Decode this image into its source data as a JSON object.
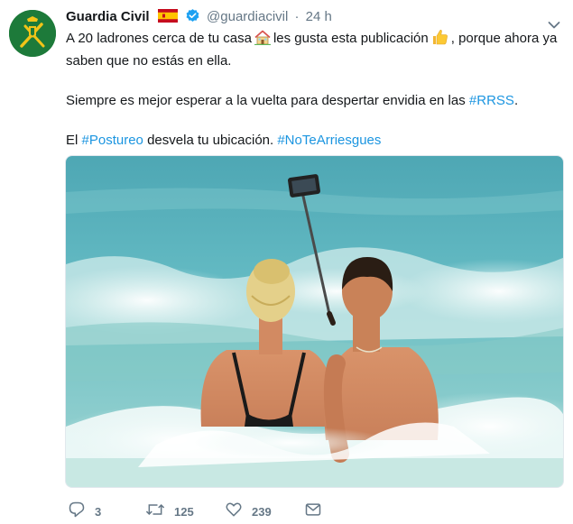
{
  "tweet": {
    "display_name": "Guardia Civil",
    "handle": "@guardiacivil",
    "separator": "·",
    "time": "24 h",
    "text": {
      "p1_a": "A 20 ladrones cerca de tu casa",
      "p1_b": "les gusta esta publicación",
      "p1_c": ", porque ahora ya saben que no estás en ella.",
      "p2_a": "Siempre es mejor esperar a la vuelta para despertar envidia en las",
      "p2_tag": "#RRSS",
      "p2_end": ".",
      "p3_a": "El",
      "p3_tag1": "#Postureo",
      "p3_b": "desvela tu ubicación.",
      "p3_tag2": "#NoTeArriesgues"
    },
    "icons": {
      "flag": "spain-flag-icon",
      "verified": "verified-badge-icon",
      "house": "house-emoji-icon",
      "thumbs": "thumbs-up-emoji-icon",
      "menu": "chevron-down-icon",
      "reply": "reply-icon",
      "retweet": "retweet-icon",
      "like": "heart-icon",
      "dm": "envelope-icon"
    },
    "stats": {
      "replies": "3",
      "retweets": "125",
      "likes": "239"
    },
    "colors": {
      "link": "#1b95e0",
      "muted": "#657786",
      "verified": "#1da1f2",
      "avatar_bg": "#1d7a3a",
      "avatar_emblem": "#f2c418"
    }
  }
}
